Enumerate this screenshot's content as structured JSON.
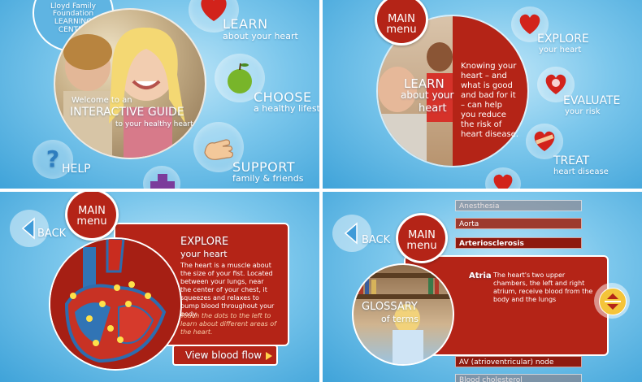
{
  "panel1": {
    "logo_line1": "Lloyd Family",
    "logo_line2": "Foundation",
    "logo_line3": "LEARNING",
    "logo_line4": "CENTER",
    "welcome_line1": "Welcome to an",
    "welcome_line2": "INTERACTIVE GUIDE",
    "welcome_line3": "to your healthy heart",
    "learn_title": "LEARN",
    "learn_sub": "about your heart",
    "choose_title": "CHOOSE",
    "choose_sub": "a healthy lifesty",
    "support_title": "SUPPORT",
    "support_sub": "family & friends",
    "help_label": "HELP",
    "help_glyph": "?"
  },
  "panel2": {
    "menu_line1": "MAIN",
    "menu_line2": "menu",
    "learn_line1": "LEARN",
    "learn_line2": "about your",
    "learn_line3": "heart",
    "description": "Knowing your heart – and what is good and bad for it – can help you reduce the risk of heart disease.",
    "explore_title": "EXPLORE",
    "explore_sub": "your heart",
    "evaluate_title": "EVALUATE",
    "evaluate_sub": "your risk",
    "treat_title": "TREAT",
    "treat_sub": "heart disease"
  },
  "panel3": {
    "menu_line1": "MAIN",
    "menu_line2": "menu",
    "back_label": "BACK",
    "explore_title": "EXPLORE",
    "explore_sub": "your heart",
    "body": "The heart is a muscle about the size of your fist. Located between your lungs, near the center of your chest, it squeezes and relaxes to pump blood throughout your body.",
    "instruction": "Touch the dots to the left to learn about different areas of the heart.",
    "flow_button": "View blood flow"
  },
  "panel4": {
    "menu_line1": "MAIN",
    "menu_line2": "menu",
    "back_label": "BACK",
    "glossary_line1": "GLOSSARY",
    "glossary_line2": "of terms",
    "terms": [
      "Anesthesia",
      "Aorta",
      "Arteriosclerosis"
    ],
    "term_below": "AV (atrioventricular) node",
    "term_cut": "Blood cholesterol",
    "def_term": "Atria",
    "def_text": "The heart's two upper chambers, the left and right atrium, receive blood from the body and the lungs"
  },
  "colors": {
    "red": "#b42417",
    "dark_red": "#8e1a0f",
    "sky": "#7cc7ec",
    "dot": "#ffe14a"
  }
}
